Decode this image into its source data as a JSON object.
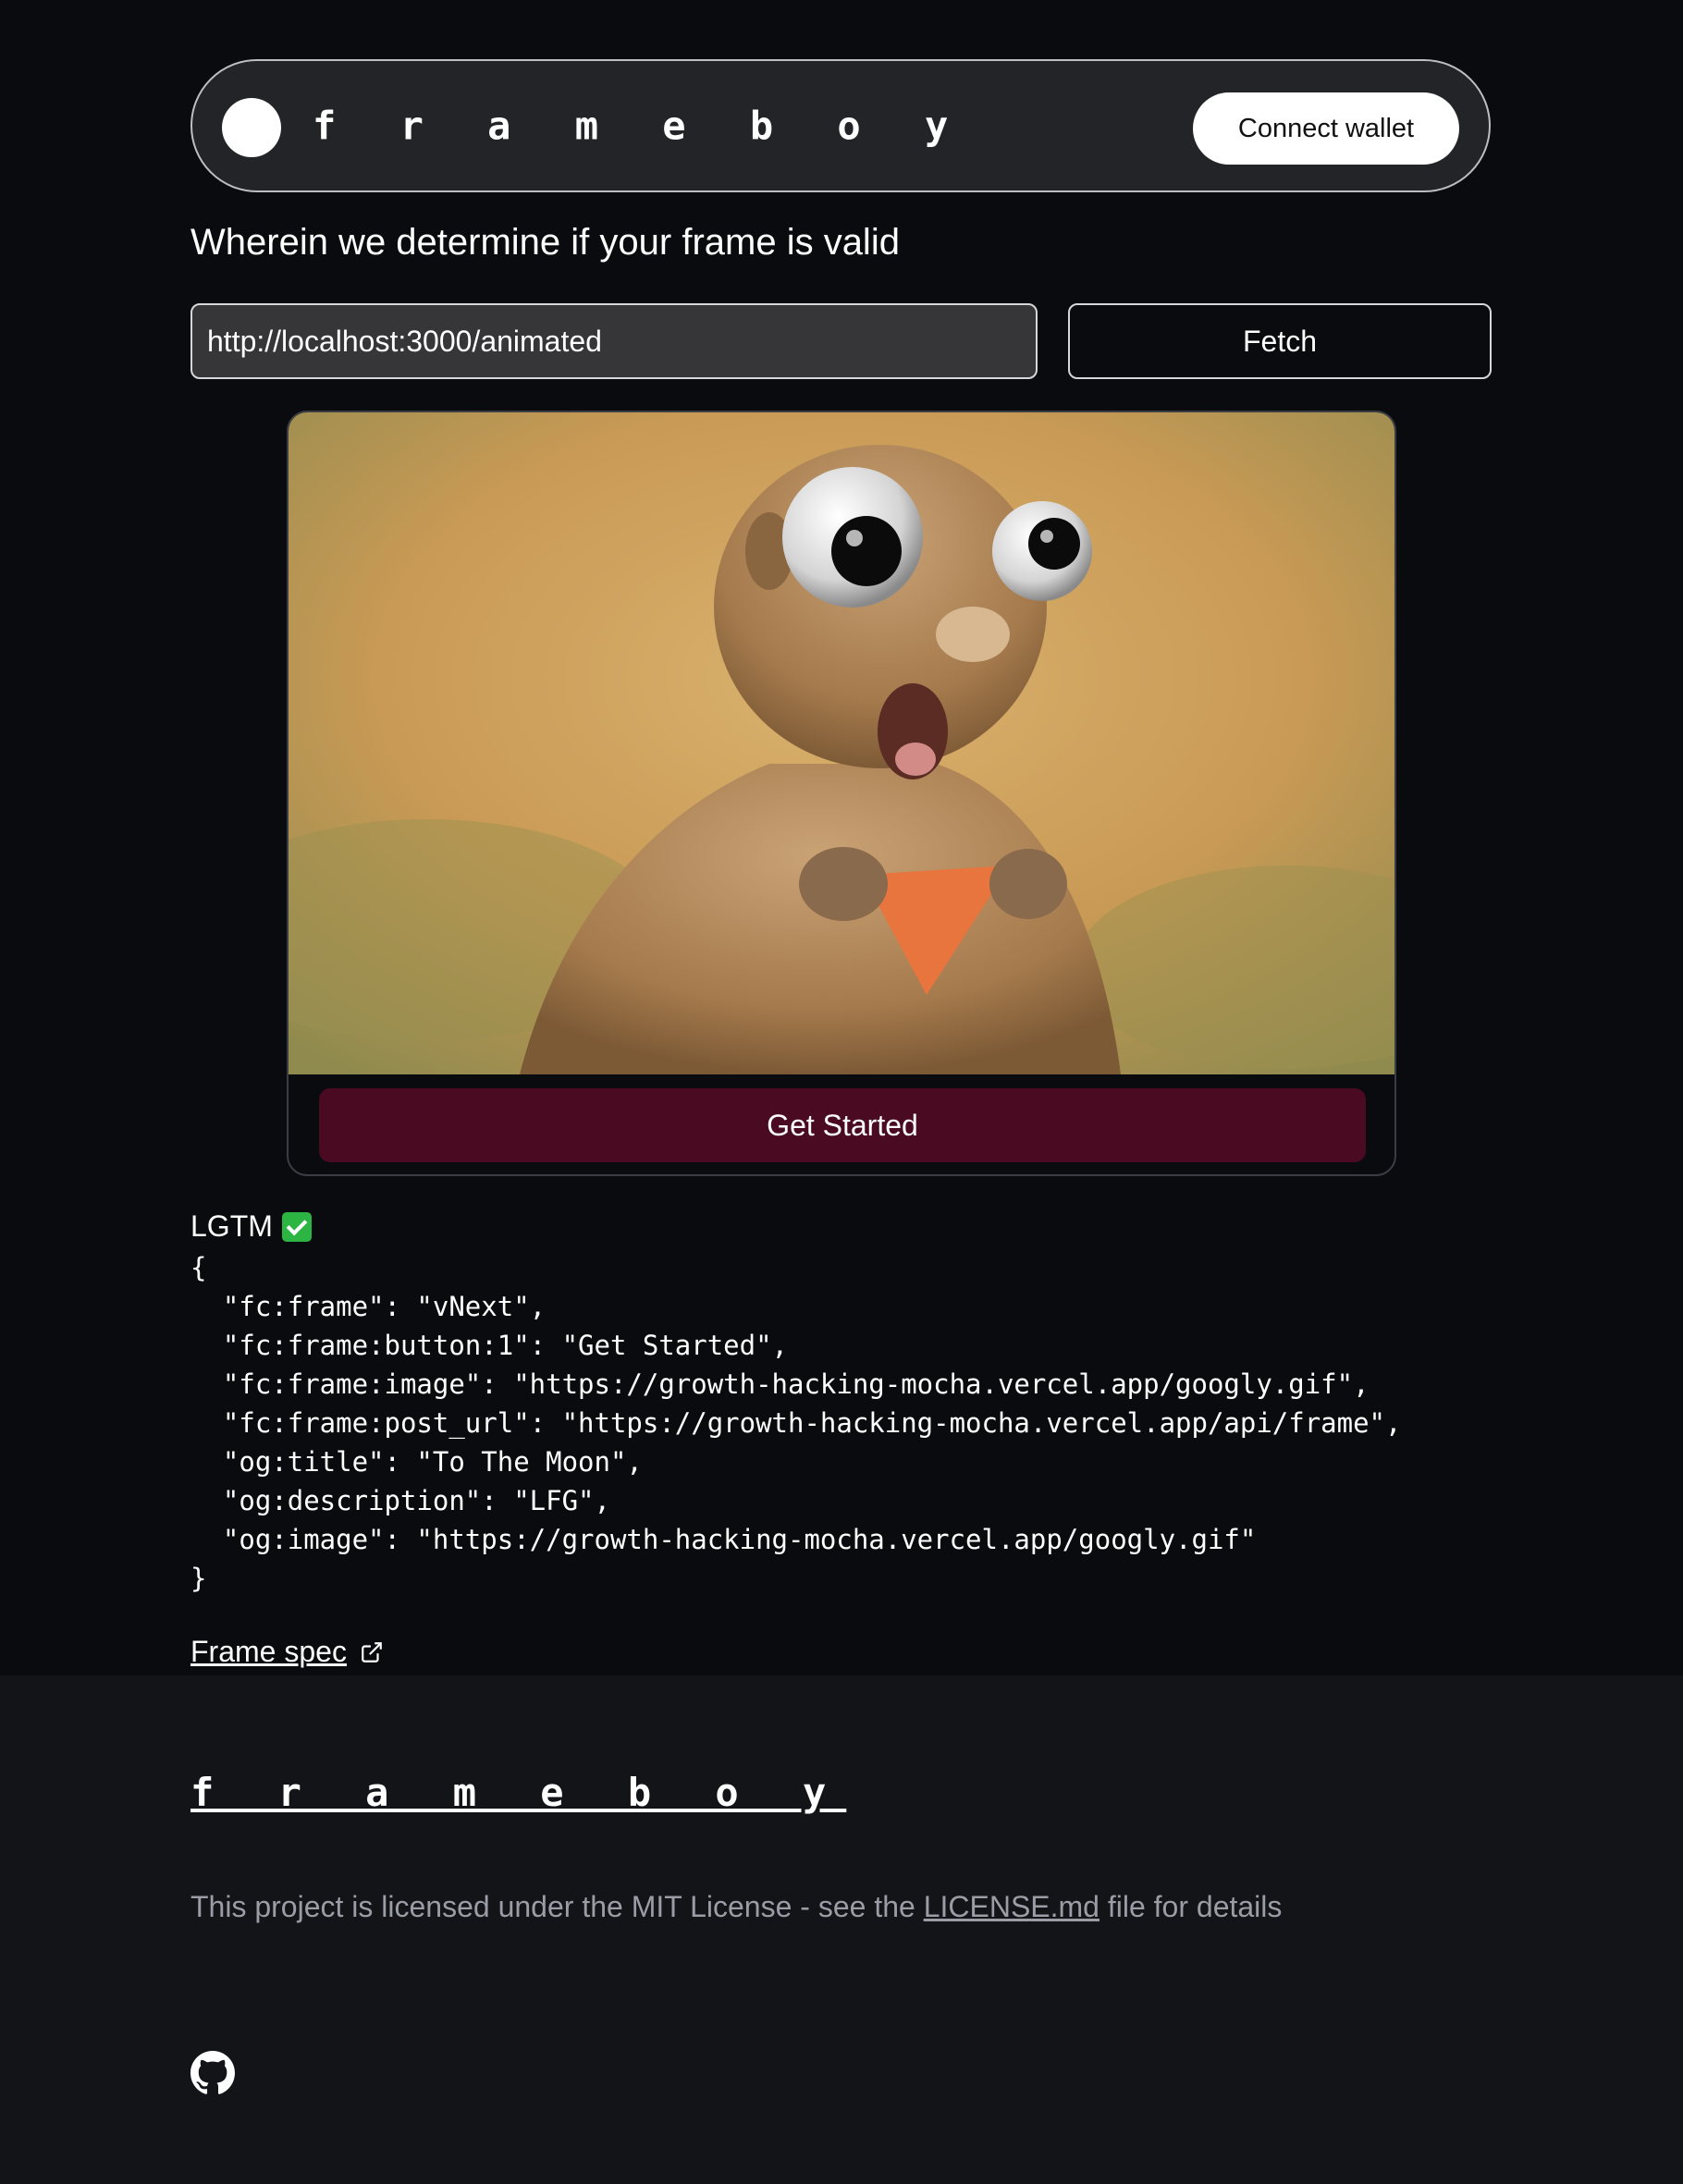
{
  "header": {
    "brand": "f r a m e b o y",
    "connect_label": "Connect wallet"
  },
  "subtitle": "Wherein we determine if your frame is valid",
  "url_input": {
    "value": "http://localhost:3000/animated"
  },
  "fetch_label": "Fetch",
  "frame": {
    "button_label": "Get Started"
  },
  "status": {
    "text": "LGTM"
  },
  "json_output": "{\n  \"fc:frame\": \"vNext\",\n  \"fc:frame:button:1\": \"Get Started\",\n  \"fc:frame:image\": \"https://growth-hacking-mocha.vercel.app/googly.gif\",\n  \"fc:frame:post_url\": \"https://growth-hacking-mocha.vercel.app/api/frame\",\n  \"og:title\": \"To The Moon\",\n  \"og:description\": \"LFG\",\n  \"og:image\": \"https://growth-hacking-mocha.vercel.app/googly.gif\"\n}",
  "spec_link": "Frame spec",
  "footer": {
    "brand": "f r a m e b o y",
    "license_prefix": "This project is licensed under the MIT License - see the ",
    "license_link": "LICENSE.md",
    "license_suffix": " file for details"
  },
  "colors": {
    "background": "#0a0b0e",
    "footer_background": "#131418",
    "frame_button": "#4a0a22",
    "check_green": "#2db544"
  },
  "icons": [
    "external-link-icon",
    "github-icon",
    "check-icon"
  ]
}
